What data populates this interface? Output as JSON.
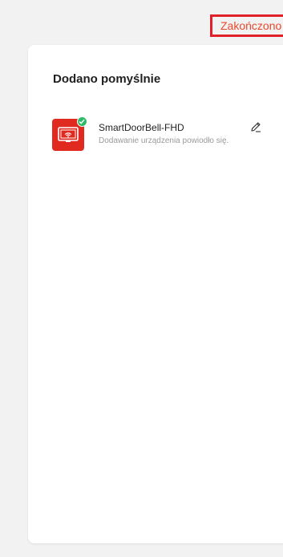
{
  "header": {
    "done_label": "Zakończono"
  },
  "card": {
    "title": "Dodano pomyślnie",
    "devices": [
      {
        "name": "SmartDoorBell-FHD",
        "status": "Dodawanie urządzenia powiodło się.",
        "icon": "doorbell-device-icon",
        "badge": "check-badge-icon"
      }
    ]
  },
  "colors": {
    "accent": "#e8492c",
    "highlight_border": "#e0202a",
    "device_icon_bg": "#e02a1f",
    "success_badge": "#2fba6a",
    "page_bg": "#f2f2f2"
  }
}
